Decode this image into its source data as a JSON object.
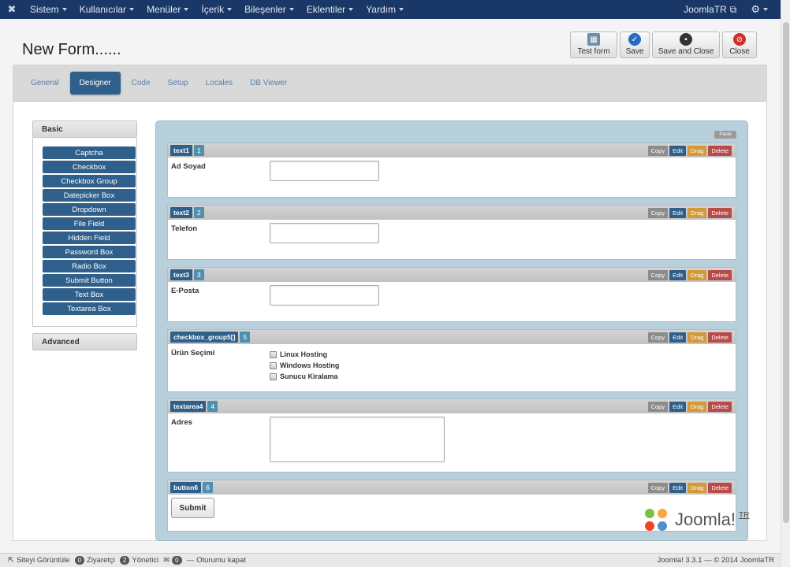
{
  "nav": {
    "items": [
      "Sistem",
      "Kullanıcılar",
      "Menüler",
      "İçerik",
      "Bileşenler",
      "Eklentiler",
      "Yardım"
    ],
    "site_label": "JoomlaTR"
  },
  "header": {
    "title": "New Form......",
    "toolbar": {
      "test_form": "Test form",
      "save": "Save",
      "save_close": "Save and Close",
      "close": "Close"
    }
  },
  "tabs": [
    "General",
    "Designer",
    "Code",
    "Setup",
    "Locales",
    "DB Viewer"
  ],
  "active_tab": "Designer",
  "palette": {
    "basic_label": "Basic",
    "items": [
      "Captcha",
      "Checkbox",
      "Checkbox Group",
      "Datepicker Box",
      "Dropdown",
      "File Field",
      "Hidden Field",
      "Password Box",
      "Radio Box",
      "Submit Button",
      "Text Box",
      "Textarea Box"
    ],
    "advanced_label": "Advanced"
  },
  "canvas": {
    "paste_label": "Paste",
    "actions": {
      "copy": "Copy",
      "edit": "Edit",
      "drag": "Drag",
      "delete": "Delete"
    },
    "fields": [
      {
        "name": "text1",
        "num": "1",
        "label": "Ad Soyad"
      },
      {
        "name": "text2",
        "num": "2",
        "label": "Telefon"
      },
      {
        "name": "text3",
        "num": "3",
        "label": "E-Posta"
      },
      {
        "name": "checkbox_group5[]",
        "num": "5",
        "label": "Ürün Seçimi",
        "options": [
          "Linux Hosting",
          "Windows Hosting",
          "Sunucu Kiralama"
        ]
      },
      {
        "name": "textarea4",
        "num": "4",
        "label": "Adres"
      },
      {
        "name": "button6",
        "num": "6",
        "button_text": "Submit"
      }
    ]
  },
  "watermark": {
    "text": "Joomla!",
    "suffix": "TR"
  },
  "footer": {
    "view_site": "Siteyi Görüntüle",
    "visitors_count": "0",
    "visitors_label": "Ziyaretçi",
    "admins_count": "2",
    "admins_label": "Yönetici",
    "messages_count": "0",
    "logout": "Oturumu kapat",
    "version": "Joomla! 3.3.1 — © 2014 JoomlaTR"
  }
}
